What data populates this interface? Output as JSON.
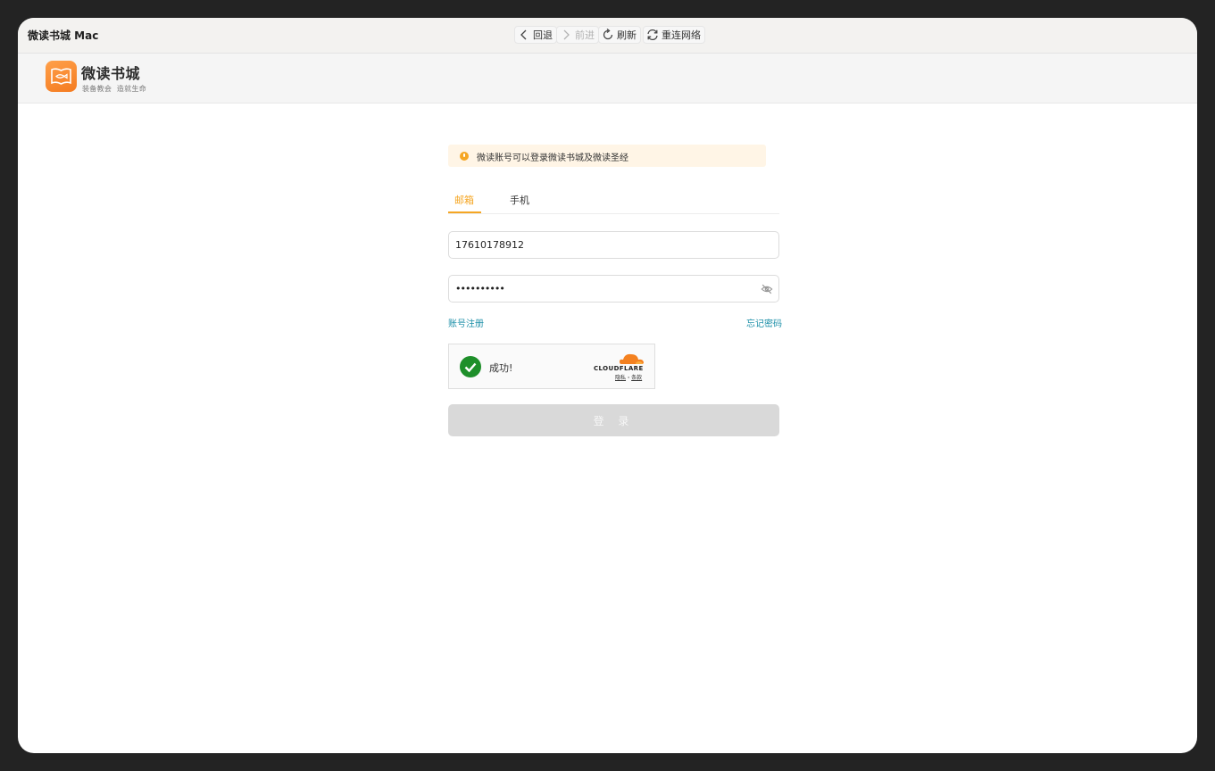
{
  "window": {
    "title": "微读书城 Mac",
    "toolbar": {
      "back": "回退",
      "forward": "前进",
      "refresh": "刷新",
      "reconnect": "重连网络"
    }
  },
  "header": {
    "title": "微读书城",
    "subtitle": "装备教会  造就生命"
  },
  "notice": {
    "text": "微读账号可以登录微读书城及微读圣经",
    "color": "#f5a623"
  },
  "tabs": [
    {
      "label": "邮箱",
      "active": true
    },
    {
      "label": "手机",
      "active": false
    }
  ],
  "form": {
    "account_value": "17610178912",
    "password_masked": "••••••••••"
  },
  "links": {
    "register": "账号注册",
    "forgot": "忘记密码"
  },
  "captcha": {
    "status": "成功!",
    "brand": "CLOUDFLARE",
    "privacy": "隐私",
    "separator": "·",
    "terms": "条款"
  },
  "login_button": "登 录",
  "colors": {
    "accent": "#f5a623",
    "link": "#1c8fa8",
    "success": "#1e8f2a"
  }
}
